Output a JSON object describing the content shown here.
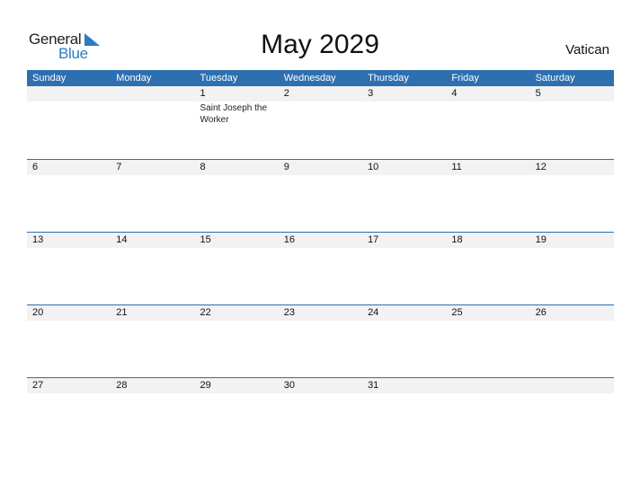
{
  "logo": {
    "part1": "General",
    "part2": "Blue"
  },
  "title": "May 2029",
  "country": "Vatican",
  "colors": {
    "accent": "#2e6fb0",
    "strip": "#f2f2f2"
  },
  "weekdays": [
    "Sunday",
    "Monday",
    "Tuesday",
    "Wednesday",
    "Thursday",
    "Friday",
    "Saturday"
  ],
  "weeks": [
    {
      "days": [
        "",
        "",
        "1",
        "2",
        "3",
        "4",
        "5"
      ],
      "events": [
        "",
        "",
        "Saint Joseph the Worker",
        "",
        "",
        "",
        ""
      ]
    },
    {
      "days": [
        "6",
        "7",
        "8",
        "9",
        "10",
        "11",
        "12"
      ],
      "events": [
        "",
        "",
        "",
        "",
        "",
        "",
        ""
      ]
    },
    {
      "days": [
        "13",
        "14",
        "15",
        "16",
        "17",
        "18",
        "19"
      ],
      "events": [
        "",
        "",
        "",
        "",
        "",
        "",
        ""
      ]
    },
    {
      "days": [
        "20",
        "21",
        "22",
        "23",
        "24",
        "25",
        "26"
      ],
      "events": [
        "",
        "",
        "",
        "",
        "",
        "",
        ""
      ]
    },
    {
      "days": [
        "27",
        "28",
        "29",
        "30",
        "31",
        "",
        ""
      ],
      "events": [
        "",
        "",
        "",
        "",
        "",
        "",
        ""
      ]
    }
  ]
}
